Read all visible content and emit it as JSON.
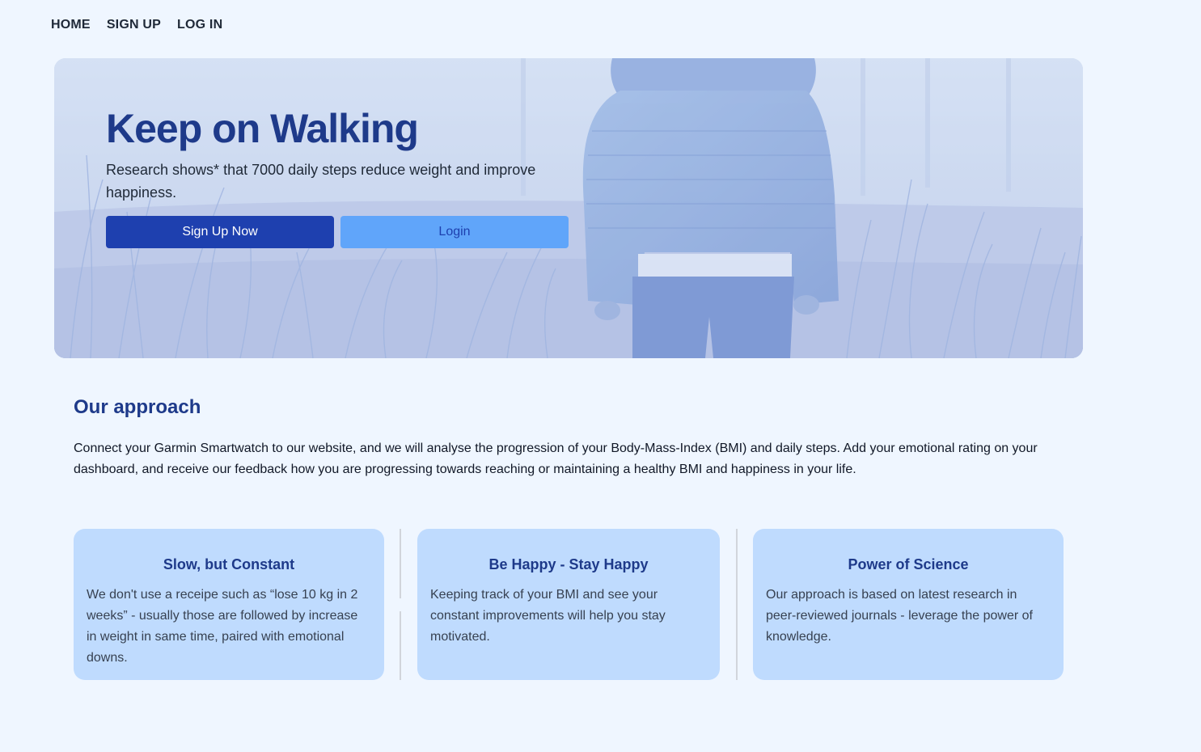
{
  "nav": {
    "items": [
      "HOME",
      "SIGN UP",
      "LOG IN"
    ]
  },
  "hero": {
    "title": "Keep on Walking",
    "subtitle": "Research shows* that 7000 daily steps reduce weight and improve happiness.",
    "primary_button": "Sign Up Now",
    "secondary_button": "Login"
  },
  "approach": {
    "heading": "Our approach",
    "text": "Connect your Garmin Smartwatch to our website, and we will analyse the progression of your Body-Mass-Index (BMI) and daily steps. Add your emotional rating on your dashboard, and receive our feedback how you are progressing towards reaching or maintaining a healthy BMI and happiness in your life."
  },
  "cards": [
    {
      "title": "Slow, but Constant",
      "text": "We don't use a receipe such as “lose 10 kg in 2 weeks” - usually those are followed by increase in weight in same time, paired with emotional downs."
    },
    {
      "title": "Be Happy - Stay Happy",
      "text": "Keeping track of your BMI and see your constant improvements will help you stay motivated."
    },
    {
      "title": "Power of Science",
      "text": "Our approach is based on latest research in peer-reviewed journals - leverage the power of knowledge."
    }
  ],
  "colors": {
    "background": "#eff6ff",
    "accent_dark": "#1e40af",
    "accent_light": "#60a5fa",
    "heading": "#1e3a8a",
    "card": "#bfdbfe"
  }
}
